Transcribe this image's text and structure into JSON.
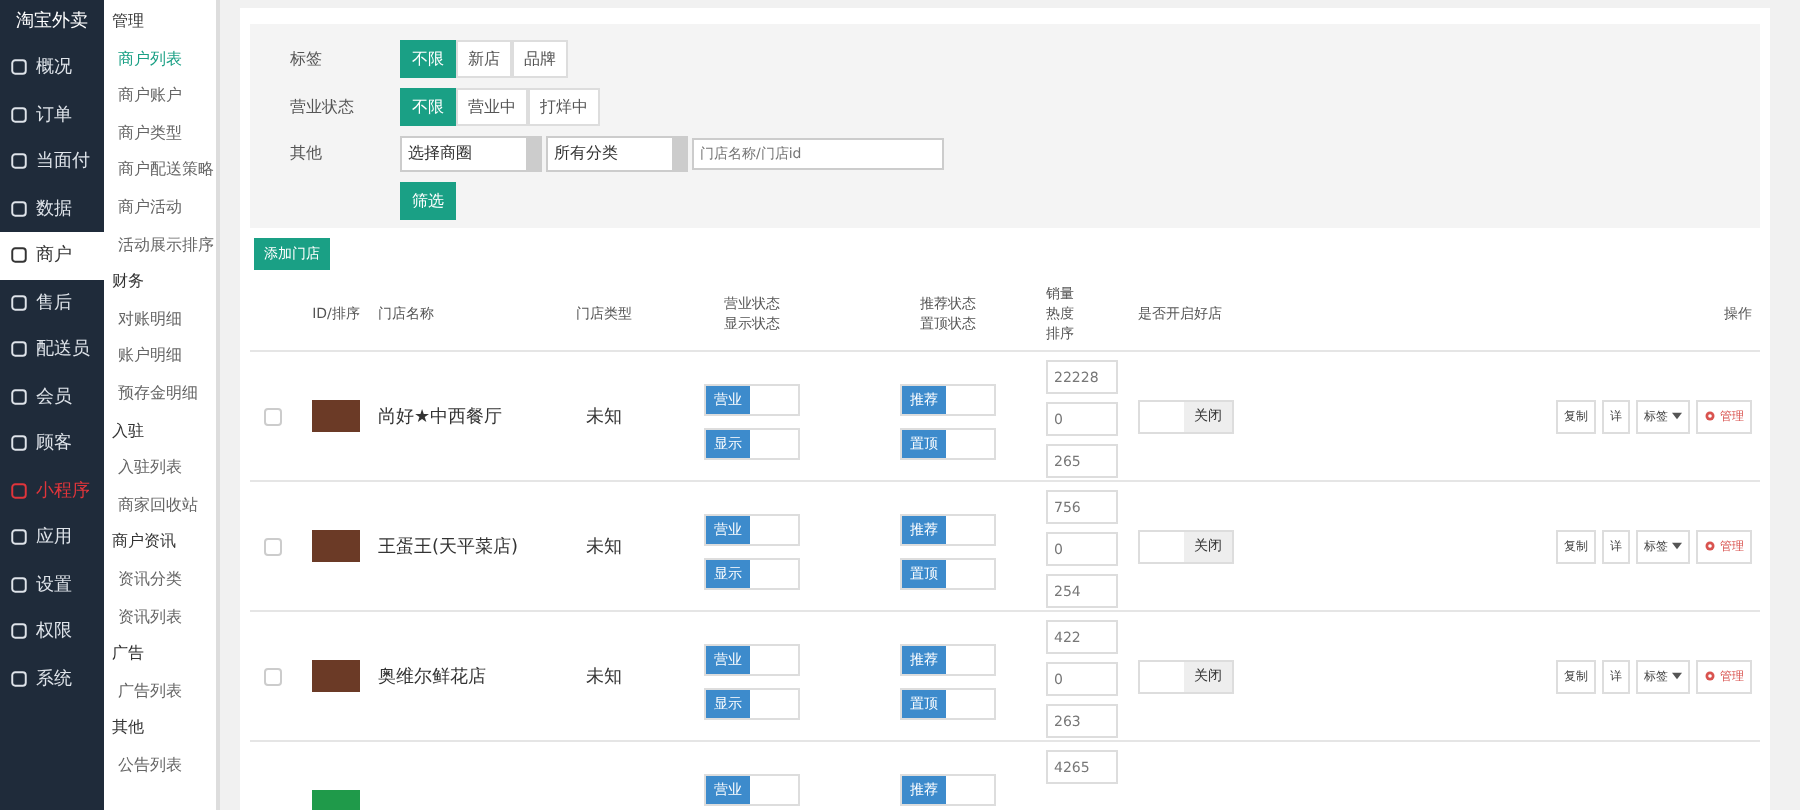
{
  "brand": "淘宝外卖",
  "nav": [
    {
      "label": "概况",
      "selected": false,
      "kind": "normal"
    },
    {
      "label": "订单",
      "selected": false,
      "kind": "normal"
    },
    {
      "label": "当面付",
      "selected": false,
      "kind": "normal"
    },
    {
      "label": "数据",
      "selected": false,
      "kind": "normal"
    },
    {
      "label": "商户",
      "selected": true,
      "kind": "normal"
    },
    {
      "label": "售后",
      "selected": false,
      "kind": "normal"
    },
    {
      "label": "配送员",
      "selected": false,
      "kind": "normal"
    },
    {
      "label": "会员",
      "selected": false,
      "kind": "normal"
    },
    {
      "label": "顾客",
      "selected": false,
      "kind": "normal"
    },
    {
      "label": "小程序",
      "selected": false,
      "kind": "alert"
    },
    {
      "label": "应用",
      "selected": false,
      "kind": "normal"
    },
    {
      "label": "设置",
      "selected": false,
      "kind": "normal"
    },
    {
      "label": "权限",
      "selected": false,
      "kind": "normal"
    },
    {
      "label": "系统",
      "selected": false,
      "kind": "normal"
    }
  ],
  "submenu": [
    {
      "group": "管理",
      "items": [
        {
          "label": "商户列表",
          "selected": true
        },
        {
          "label": "商户账户",
          "selected": false
        },
        {
          "label": "商户类型",
          "selected": false
        },
        {
          "label": "商户配送策略",
          "selected": false
        },
        {
          "label": "商户活动",
          "selected": false
        },
        {
          "label": "活动展示排序",
          "selected": false
        }
      ]
    },
    {
      "group": "财务",
      "items": [
        {
          "label": "对账明细",
          "selected": false
        },
        {
          "label": "账户明细",
          "selected": false
        },
        {
          "label": "预存金明细",
          "selected": false
        }
      ]
    },
    {
      "group": "入驻",
      "items": [
        {
          "label": "入驻列表",
          "selected": false
        },
        {
          "label": "商家回收站",
          "selected": false
        }
      ]
    },
    {
      "group": "商户资讯",
      "items": [
        {
          "label": "资讯分类",
          "selected": false
        },
        {
          "label": "资讯列表",
          "selected": false
        }
      ]
    },
    {
      "group": "广告",
      "items": [
        {
          "label": "广告列表",
          "selected": false
        }
      ]
    },
    {
      "group": "其他",
      "items": [
        {
          "label": "公告列表",
          "selected": false
        }
      ]
    }
  ],
  "filters": [
    {
      "label": "标签",
      "options": [
        {
          "label": "不限",
          "selected": true
        },
        {
          "label": "新店",
          "selected": false
        },
        {
          "label": "品牌",
          "selected": false
        }
      ]
    },
    {
      "label": "营业状态",
      "options": [
        {
          "label": "不限",
          "selected": true
        },
        {
          "label": "营业中",
          "selected": false
        },
        {
          "label": "打烊中",
          "selected": false
        }
      ]
    }
  ],
  "other": {
    "label": "其他",
    "selects": [
      "选择商圈",
      "所有分类"
    ],
    "search": {
      "placeholder": "门店名称/门店id"
    }
  },
  "filter_button": "筛选",
  "add_button": "添加门店",
  "columns": [
    "ID/排序",
    "门店名称",
    "门店类型",
    [
      "营业状态",
      "显示状态"
    ],
    [
      "推荐状态",
      "置顶状态"
    ],
    [
      "销量",
      "热度",
      "排序"
    ],
    "是否开启好店",
    "操作"
  ],
  "rows": [
    {
      "checked": false,
      "name": "尚好★中西餐厅",
      "type": "未知",
      "switches": [
        [
          {
            "label": "营业",
            "on": true
          },
          {
            "label": "显示",
            "on": true
          }
        ],
        [
          {
            "label": "推荐",
            "on": true
          },
          {
            "label": "置顶",
            "on": true
          }
        ]
      ],
      "numbers": [
        "22228",
        "0",
        "265"
      ],
      "good_store": {
        "label": "关闭",
        "on": false
      },
      "actions": [
        "复制",
        "详",
        "标签",
        "管理"
      ]
    },
    {
      "checked": false,
      "name": "王蛋王(天平菜店)",
      "type": "未知",
      "switches": [
        [
          {
            "label": "营业",
            "on": true
          },
          {
            "label": "显示",
            "on": true
          }
        ],
        [
          {
            "label": "推荐",
            "on": true
          },
          {
            "label": "置顶",
            "on": true
          }
        ]
      ],
      "numbers": [
        "756",
        "0",
        "254"
      ],
      "good_store": {
        "label": "关闭",
        "on": false
      },
      "actions": [
        "复制",
        "详",
        "标签",
        "管理"
      ]
    },
    {
      "checked": false,
      "name": "奥维尔鲜花店",
      "type": "未知",
      "switches": [
        [
          {
            "label": "营业",
            "on": true
          },
          {
            "label": "显示",
            "on": true
          }
        ],
        [
          {
            "label": "推荐",
            "on": true
          },
          {
            "label": "置顶",
            "on": true
          }
        ]
      ],
      "numbers": [
        "422",
        "0",
        "263"
      ],
      "good_store": {
        "label": "关闭",
        "on": false
      },
      "actions": [
        "复制",
        "详",
        "标签",
        "管理"
      ]
    },
    {
      "switches": [
        [
          {
            "label": "营业",
            "on": true
          }
        ],
        [
          {
            "label": "推荐",
            "on": true
          }
        ]
      ],
      "numbers": [
        "4265"
      ]
    }
  ]
}
